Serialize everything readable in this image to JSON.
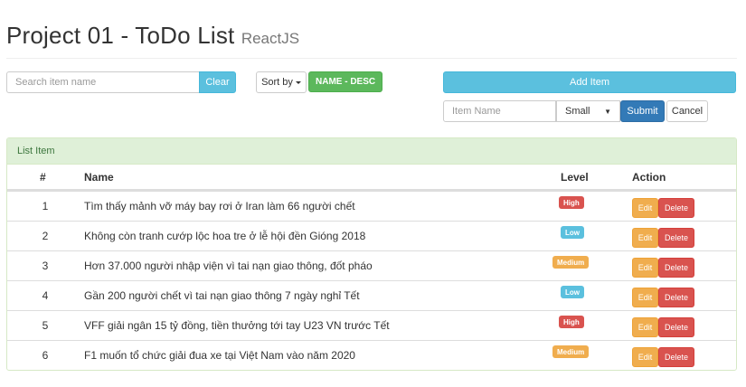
{
  "header": {
    "title": "Project 01 - ToDo List",
    "subtitle": "ReactJS"
  },
  "search": {
    "placeholder": "Search item name",
    "clear_label": "Clear"
  },
  "sort": {
    "button_label": "Sort by",
    "current": "NAME - DESC"
  },
  "form": {
    "add_label": "Add Item",
    "name_placeholder": "Item Name",
    "level_selected": "Small",
    "submit_label": "Submit",
    "cancel_label": "Cancel"
  },
  "panel": {
    "heading": "List Item"
  },
  "table": {
    "columns": {
      "num": "#",
      "name": "Name",
      "level": "Level",
      "action": "Action"
    },
    "edit_label": "Edit",
    "delete_label": "Delete",
    "rows": [
      {
        "num": "1",
        "name": "Tìm thấy mảnh vỡ máy bay rơi ở Iran làm 66 người chết",
        "level": "High"
      },
      {
        "num": "2",
        "name": "Không còn tranh cướp lộc hoa tre ở lễ hội đền Gióng 2018",
        "level": "Low"
      },
      {
        "num": "3",
        "name": "Hơn 37.000 người nhập viện vì tai nạn giao thông, đốt pháo",
        "level": "Medium"
      },
      {
        "num": "4",
        "name": "Gần 200 người chết vì tai nạn giao thông 7 ngày nghỉ Tết",
        "level": "Low"
      },
      {
        "num": "5",
        "name": "VFF giải ngân 15 tỷ đồng, tiền thưởng tới tay U23 VN trước Tết",
        "level": "High"
      },
      {
        "num": "6",
        "name": "F1 muốn tổ chức giải đua xe tại Việt Nam vào năm 2020",
        "level": "Medium"
      }
    ]
  },
  "colors": {
    "info": "#5bc0de",
    "success": "#5cb85c",
    "primary": "#337ab7",
    "warning": "#f0ad4e",
    "danger": "#d9534f",
    "panel_heading_bg": "#dff0d8"
  }
}
